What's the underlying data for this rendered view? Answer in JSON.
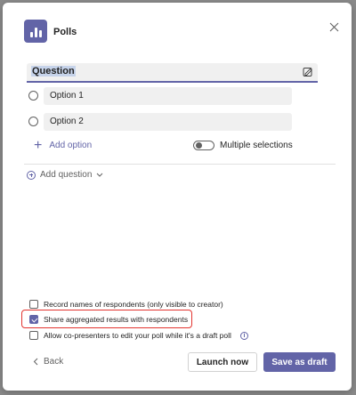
{
  "header": {
    "title": "Polls",
    "app_icon": "poll-bar-chart-icon",
    "close_icon": "close-icon"
  },
  "question": {
    "value": "Question",
    "icon": "edit-form-icon"
  },
  "options": [
    {
      "label": "Option 1"
    },
    {
      "label": "Option 2"
    }
  ],
  "add_option_label": "Add option",
  "multiple_selections": {
    "label": "Multiple selections",
    "on": false
  },
  "add_question_label": "Add question",
  "settings": {
    "record_names": {
      "label": "Record names of respondents (only visible to creator)",
      "checked": false
    },
    "share_results": {
      "label": "Share aggregated results with respondents",
      "checked": true
    },
    "allow_copresenters": {
      "label": "Allow co-presenters to edit your poll while it's a draft poll",
      "checked": false
    }
  },
  "footer": {
    "back_label": "Back",
    "launch_label": "Launch now",
    "draft_label": "Save as draft"
  },
  "colors": {
    "accent": "#6264a7",
    "highlight_border": "#e3342f"
  }
}
